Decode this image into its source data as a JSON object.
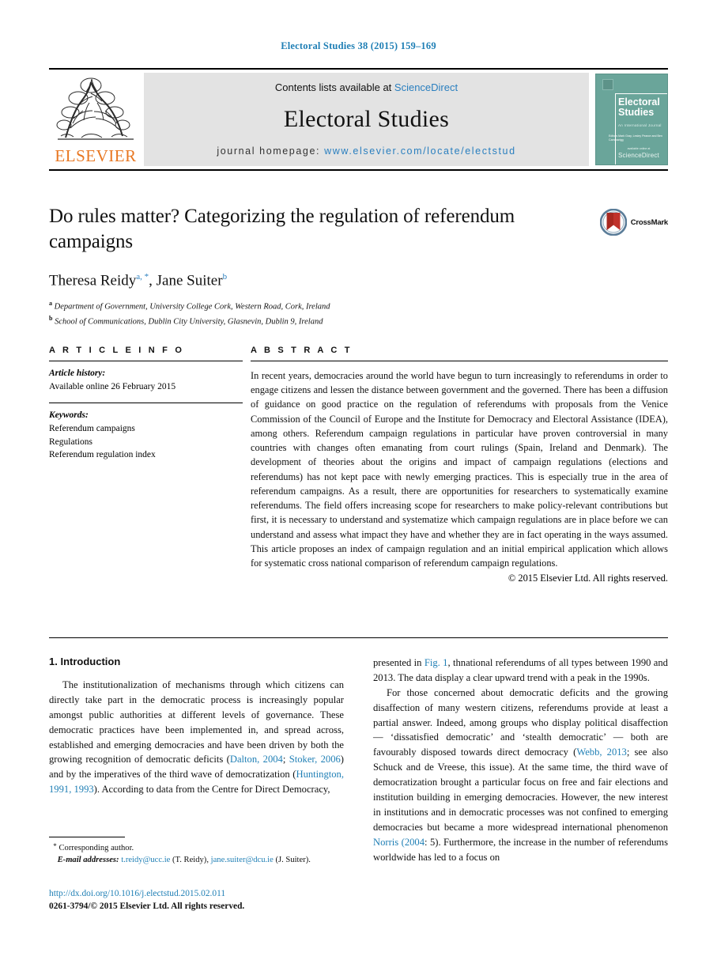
{
  "running_head": "Electoral Studies 38 (2015) 159–169",
  "masthead": {
    "contents_prefix": "Contents lists available at ",
    "contents_link": "ScienceDirect",
    "journal_title": "Electoral Studies",
    "homepage_prefix": "journal homepage: ",
    "homepage_url": "www.elsevier.com/locate/electstud",
    "publisher_logo_text": "ELSEVIER",
    "cover": {
      "title_line1": "Electoral",
      "title_line2": "Studies",
      "subtitle": "An International Journal",
      "editors": "Editors\nMark Gray, Lesley Pearce and Ben Cammarigg",
      "publisher_small": "available online at",
      "publisher_big": "ScienceDirect"
    }
  },
  "article": {
    "title": "Do rules matter? Categorizing the regulation of referendum campaigns",
    "crossmark_label": "CrossMark",
    "authors": [
      {
        "name": "Theresa Reidy",
        "marks": "a, *"
      },
      {
        "name": "Jane Suiter",
        "marks": "b"
      }
    ],
    "affiliations": [
      {
        "mark": "a",
        "text": "Department of Government, University College Cork, Western Road, Cork, Ireland"
      },
      {
        "mark": "b",
        "text": "School of Communications, Dublin City University, Glasnevin, Dublin 9, Ireland"
      }
    ]
  },
  "article_info": {
    "heading": "A R T I C L E  I N F O",
    "history_label": "Article history:",
    "history_value": "Available online 26 February 2015",
    "keywords_label": "Keywords:",
    "keywords": [
      "Referendum campaigns",
      "Regulations",
      "Referendum regulation index"
    ]
  },
  "abstract": {
    "heading": "A B S T R A C T",
    "text": "In recent years, democracies around the world have begun to turn increasingly to referendums in order to engage citizens and lessen the distance between government and the governed. There has been a diffusion of guidance on good practice on the regulation of referendums with proposals from the Venice Commission of the Council of Europe and the Institute for Democracy and Electoral Assistance (IDEA), among others. Referendum campaign regulations in particular have proven controversial in many countries with changes often emanating from court rulings (Spain, Ireland and Denmark). The development of theories about the origins and impact of campaign regulations (elections and referendums) has not kept pace with newly emerging practices. This is especially true in the area of referendum campaigns. As a result, there are opportunities for researchers to systematically examine referendums. The field offers increasing scope for researchers to make policy-relevant contributions but first, it is necessary to understand and systematize which campaign regulations are in place before we can understand and assess what impact they have and whether they are in fact operating in the ways assumed. This article proposes an index of campaign regulation and an initial empirical application which allows for systematic cross national comparison of referendum campaign regulations.",
    "copyright": "© 2015 Elsevier Ltd. All rights reserved."
  },
  "body": {
    "section_heading": "1. Introduction",
    "left_paragraph_1_a": "The institutionalization of mechanisms through which citizens can directly take part in the democratic process is increasingly popular amongst public authorities at different levels of governance. These democratic practices have been implemented in, and spread across, established and emerging democracies and have been driven by both the growing recognition of democratic deficits (",
    "left_ref_1": "Dalton, 2004",
    "left_sep_1": "; ",
    "left_ref_2": "Stoker, 2006",
    "left_paragraph_1_b": ") and by the imperatives of the third wave of democratization (",
    "left_ref_3": "Huntington, 1991, 1993",
    "left_paragraph_1_c": "). According to data from the Centre for Direct Democracy,",
    "right_paragraph_1_a": "presented in ",
    "right_ref_fig": "Fig. 1",
    "right_paragraph_1_b": ", thnational referendums of all types between 1990 and 2013. The data display a clear upward trend with a peak in the 1990s.",
    "right_paragraph_2_a": "For those concerned about democratic deficits and the growing disaffection of many western citizens, referendums provide at least a partial answer. Indeed, among groups who display political disaffection — ‘dissatisfied democratic’ and ‘stealth democratic’ — both are favourably disposed towards direct democracy (",
    "right_ref_webb": "Webb, 2013",
    "right_paragraph_2_b": "; see also Schuck and de Vreese, this issue). At the same time, the third wave of democratization brought a particular focus on free and fair elections and institution building in emerging democracies. However, the new interest in institutions and in democratic processes was not confined to emerging democracies but became a more widespread international phenomenon ",
    "right_ref_norris": "Norris (2004",
    "right_paragraph_2_c": ": 5). Furthermore, the increase in the number of referendums worldwide has led to a focus on"
  },
  "footnote": {
    "corresponding": "Corresponding author.",
    "email_label": "E-mail addresses:",
    "email_1": "t.reidy@ucc.ie",
    "email_1_owner": " (T. Reidy), ",
    "email_2": "jane.suiter@dcu.ie",
    "email_2_owner": " (J. Suiter)."
  },
  "bottom": {
    "doi": "http://dx.doi.org/10.1016/j.electstud.2015.02.011",
    "issn_line": "0261-3794/© 2015 Elsevier Ltd. All rights reserved."
  },
  "colors": {
    "link_blue": "#1f7fb5",
    "elsevier_orange": "#E87722",
    "cover_teal": "#6aa59a",
    "crossmark_red": "#c0322b"
  }
}
